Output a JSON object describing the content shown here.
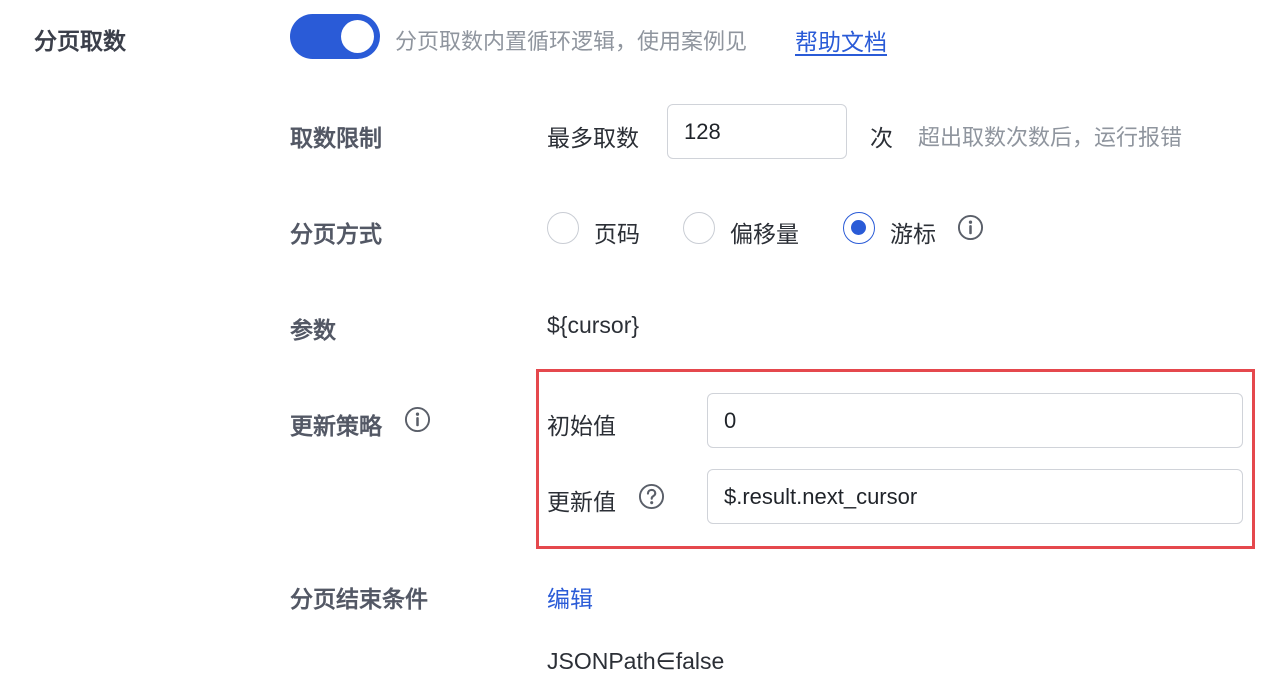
{
  "pagination": {
    "label": "分页取数",
    "enabled": true,
    "description": "分页取数内置循环逻辑，使用案例见",
    "help_link": "帮助文档"
  },
  "fetch_limit": {
    "label": "取数限制",
    "prefix": "最多取数",
    "value": "128",
    "unit": "次",
    "hint": "超出取数次数后，运行报错"
  },
  "page_mode": {
    "label": "分页方式",
    "options": [
      "页码",
      "偏移量",
      "游标"
    ],
    "selected": "游标"
  },
  "params": {
    "label": "参数",
    "value": "${cursor}"
  },
  "update_strategy": {
    "label": "更新策略",
    "initial_label": "初始值",
    "initial_value": "0",
    "update_label": "更新值",
    "update_value": "$.result.next_cursor"
  },
  "end_condition": {
    "label": "分页结束条件",
    "edit_label": "编辑",
    "value": "JSONPath∈false"
  },
  "colors": {
    "accent": "#2a5bd7",
    "highlight_border": "#e5484d"
  },
  "icons": {
    "info": "info-circle-icon",
    "help": "question-circle-icon"
  }
}
